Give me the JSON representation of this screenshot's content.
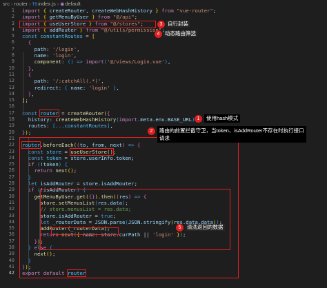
{
  "breadcrumb": {
    "parts": [
      "src",
      "router",
      "index.js",
      "default"
    ],
    "ts_badge": "TS",
    "fn_badge": "◉"
  },
  "line_numbers": {
    "n1": "1",
    "n2": "2",
    "n3": "3",
    "n4": "4",
    "n5": "5",
    "n6": "6",
    "n7": "7",
    "n8": "8",
    "n9": "9",
    "n10": "10",
    "n11": "11",
    "n12": "12",
    "n13": "13",
    "n14": "14",
    "n15": "15",
    "n16": "16",
    "n17": "17",
    "n18": "18",
    "n19": "19",
    "n20": "20",
    "n21": "21",
    "n22": "22",
    "n23": "23",
    "n24": "24",
    "n25": "25",
    "n26": "26",
    "n27": "27",
    "n28": "28",
    "n29": "29",
    "n30": "30",
    "n31": "31",
    "n32": "32",
    "n33": "33",
    "n34": "34",
    "n35": "35",
    "n36": "36",
    "n37": "37",
    "n38": "38",
    "n39": "39",
    "n40": "40",
    "n41": "41",
    "n42": "42"
  },
  "code": {
    "import_kw": "import",
    "from_kw": "from",
    "const_kw": "const",
    "let_kw": "let",
    "if_kw": "if",
    "else_kw": "else",
    "return_kw": "return",
    "export_kw": "export",
    "default_kw": "default",
    "l1_names": "createRouter, createWebHashHistory",
    "l1_src": "\"vue-router\"",
    "l2_name": "getMenuByUser",
    "l2_src": "\"@/api\"",
    "l3_name": "useUserStore",
    "l3_src": "\"@/stores\"",
    "l4_name": "addRouter",
    "l4_src": "\"@/utils/permission\"",
    "l5_name": "constantRoutes",
    "path_key": "path",
    "name_key": "name",
    "component_key": "component",
    "redirect_key": "redirect",
    "login_path": "'/login'",
    "login_name": "'login'",
    "import_call": "import",
    "login_view": "'@/views/Login.vue'",
    "catchall_path": "'/:catchAll(.*)'",
    "router_var": "router",
    "create_router": "createRouter",
    "history_key": "history",
    "create_hash": "createWebHashHistory",
    "import_meta": "import",
    "meta_rest": ".meta.env.BASE_URL",
    "routes_key": "routes",
    "spread_routes": "...constantRoutes",
    "before_each": "beforeEach",
    "params": "to, from, next",
    "store_var": "store",
    "use_store_call": "useUserStore()",
    "token_var": "token",
    "store_token": "store.userInfo.token",
    "not_token": "!token",
    "next_fn": "next",
    "is_add_router": "isAddRouter",
    "store_is_add": "store.isAddRouter",
    "not_is_add": "!isAddRouter",
    "get_menu": "getMenuByUser",
    "get_fn": "get",
    "then_fn": "then",
    "res_var": "res",
    "set_menus": "store.setMenusList",
    "res_data": "res.data",
    "comment_menus": "// store.menusList = res.data;",
    "store_is_add_assign": "store.isAddRouter",
    "true_kw": "true",
    "router_data": "_routerData",
    "json_parse": "JSON.parse",
    "json_stringify": "JSON.stringify",
    "res_data2": "res.data.data",
    "add_router_call": "addRouter(_routerData);",
    "store_cur_path": "store.curPath",
    "login_str": "'login'",
    "export_default": "router"
  },
  "annotations": {
    "a1_num": "1",
    "a1_text": "使用hash模式",
    "a2_num": "2",
    "a2_text_line1": "路由的前置拦截守卫，当token、isAddRouter不存在时执行接口",
    "a2_text_line2": "请求",
    "a3_num": "3",
    "a3_text": "自行封装",
    "a4_num": "4",
    "a4_text": "动态路由筛选",
    "a5_num": "5",
    "a5_text": "清洗返回的数据"
  },
  "colors": {
    "background": "#1e1e1e",
    "annotation_red": "#e02020",
    "keyword": "#c586c0",
    "declaration": "#569cd6",
    "string": "#ce9178",
    "variable": "#9cdcfe",
    "function": "#dcdcaa"
  }
}
